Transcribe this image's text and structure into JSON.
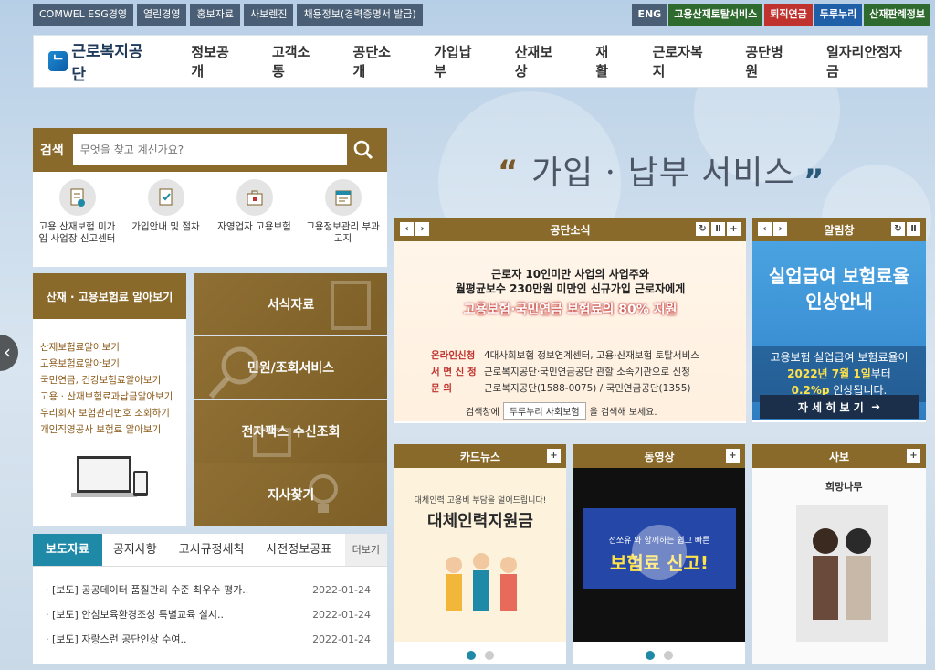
{
  "topbar_left": [
    "COMWEL ESG경영",
    "열린경영",
    "홍보자료",
    "사보렌진",
    "채용정보(경력증명서 발급)"
  ],
  "topbar_right": [
    {
      "label": "ENG",
      "color": "#4a5f75"
    },
    {
      "label": "고용산재토탈서비스",
      "color": "#2f6a2f"
    },
    {
      "label": "퇴직연금",
      "color": "#c0322e"
    },
    {
      "label": "두루누리",
      "color": "#1f5fa8"
    },
    {
      "label": "산재판례정보",
      "color": "#2f6a2f"
    }
  ],
  "logo": {
    "text": "근로복지공단"
  },
  "menu": [
    "정보공개",
    "고객소통",
    "공단소개",
    "가입납부",
    "산재보상",
    "재활",
    "근로자복지",
    "공단병원",
    "일자리안정자금"
  ],
  "search": {
    "label": "검색",
    "placeholder": "무엇을 찾고 계신가요?"
  },
  "quick_links": [
    {
      "label": "고용·산재보험 미가입 사업장 신고센터",
      "icon": "report-doc-icon"
    },
    {
      "label": "가입안내 및 절차",
      "icon": "check-doc-icon"
    },
    {
      "label": "자영업자 고용보험",
      "icon": "briefcase-icon"
    },
    {
      "label": "고용정보관리 부과고지",
      "icon": "calendar-icon"
    }
  ],
  "insurance": {
    "title": "산재 · 고용보험료 알아보기",
    "items": [
      "산재보험료알아보기",
      "고용보험료알아보기",
      "국민연금, 건강보험료알아보기",
      "고용 · 산재보험료과납금알아보기",
      "우리회사 보험관리번호 조회하기",
      "개인직영공사 보험료 알아보기"
    ]
  },
  "tiles": [
    "서식자료",
    "민원/조회서비스",
    "전자팩스 수신조회",
    "지사찾기"
  ],
  "news": {
    "tabs": [
      "보도자료",
      "공지사항",
      "고시규정세칙",
      "사전정보공표"
    ],
    "more": "더보기",
    "rows": [
      {
        "title": "[보도] 공공데이터 품질관리 수준 최우수 평가..",
        "date": "2022-01-24"
      },
      {
        "title": "[보도] 안심보육환경조성 특별교육 실시..",
        "date": "2022-01-24"
      },
      {
        "title": "[보도] 자랑스런 공단인상 수여..",
        "date": "2022-01-24"
      }
    ]
  },
  "hero": {
    "title": "가입 · 납부 서비스"
  },
  "gongdan": {
    "title": "공단소식",
    "line1": "근로자 10인미만 사업의 사업주와",
    "line2": "월평균보수 230만원 미만인 신규가입 근로자에게",
    "line3": "고용보험·국민연금 보험료의 80% 지원",
    "info": [
      {
        "k": "온라인신청",
        "v": "4대사회보험 정보연계센터, 고용·산재보험 토탈서비스"
      },
      {
        "k": "서 면 신 청",
        "v": "근로복지공단·국민연금공단 관할 소속기관으로 신청"
      },
      {
        "k": "문      의",
        "v": "근로복지공단(1588-0075) / 국민연금공단(1355)"
      }
    ],
    "search_pre": "검색창에",
    "search_box": "두루누리 사회보험",
    "search_post": "을 검색해 보세요."
  },
  "alarm": {
    "title": "알림창",
    "headline1": "실업급여 보험료율",
    "headline2": "인상안내",
    "sub1": "고용보험 실업급여 보험료율이",
    "date": "2022년 7월 1일",
    "sub2": "부터",
    "rate": "0.2%p",
    "sub3": "인상됩니다.",
    "button": "자 세 히 보 기"
  },
  "cards": [
    {
      "title": "카드뉴스",
      "caption": "대체인력 고용비 부담을 덜어드립니다!",
      "headline": "대체인력지원금"
    },
    {
      "title": "동영상",
      "caption": "전쏘유 와 함께하는 쉽고 빠른",
      "headline": "보험료 신고!"
    },
    {
      "title": "사보",
      "caption": "희망나무",
      "headline": ""
    }
  ]
}
